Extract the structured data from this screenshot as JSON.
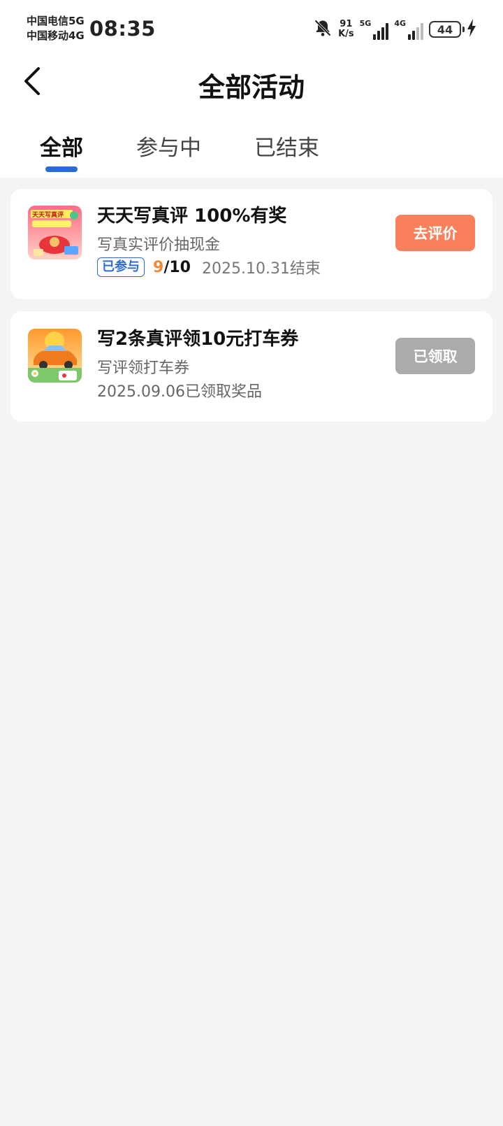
{
  "status_bar": {
    "carrier_1": "中国电信5G",
    "carrier_2": "中国移动4G",
    "time": "08:35",
    "speed_value": "91",
    "speed_unit": "K/s",
    "net_1": "5G",
    "net_2": "4G",
    "battery": "44"
  },
  "header": {
    "title": "全部活动"
  },
  "tabs": [
    {
      "label": "全部",
      "active": true
    },
    {
      "label": "参与中",
      "active": false
    },
    {
      "label": "已结束",
      "active": false
    }
  ],
  "activities": [
    {
      "thumb_text": "天天写真评",
      "title": "天天写真评 100%有奖",
      "subtitle": "写真实评价抽现金",
      "badge": "已参与",
      "progress_current": "9",
      "progress_total": "/10",
      "date": "2025.10.31结束",
      "button": "去评价",
      "button_color": "#f9805a"
    },
    {
      "title": "写2条真评领10元打车券",
      "subtitle": "写评领打车券",
      "date": "2025.09.06已领取奖品",
      "button": "已领取",
      "button_color": "#ababab"
    }
  ],
  "colors": {
    "accent": "#2c6ad8",
    "orange": "#ef8a38"
  }
}
